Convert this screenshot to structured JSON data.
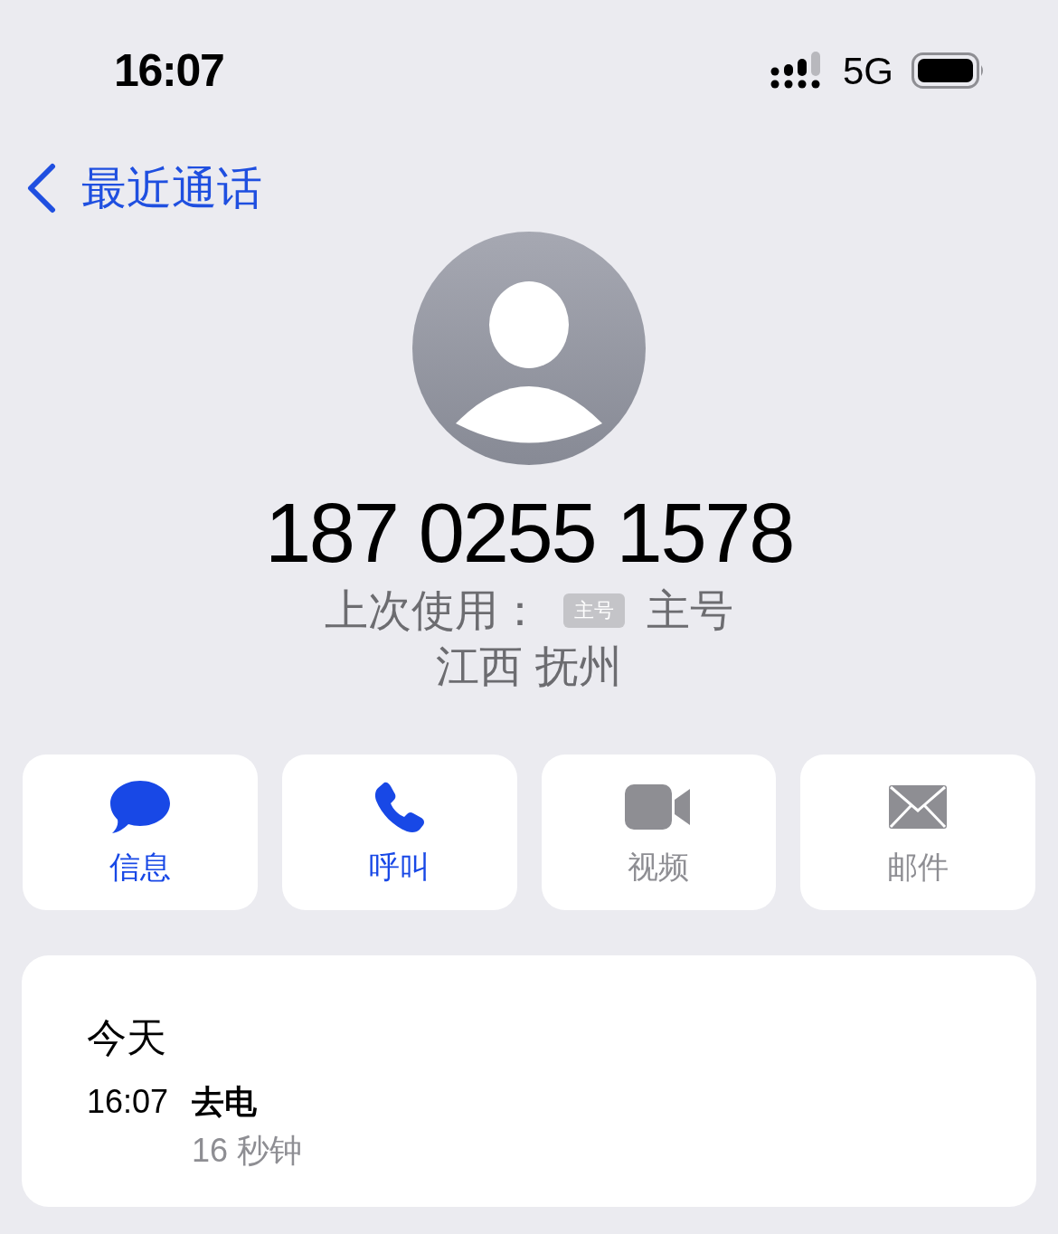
{
  "status_bar": {
    "time": "16:07",
    "network": "5G"
  },
  "nav": {
    "back_label": "最近通话"
  },
  "contact": {
    "number": "187 0255 1578",
    "last_used_label": "上次使用：",
    "line_badge": "主号",
    "line_name": "主号",
    "location": "江西 抚州"
  },
  "actions": [
    {
      "kind": "message",
      "label": "信息",
      "enabled": true
    },
    {
      "kind": "call",
      "label": "呼叫",
      "enabled": true
    },
    {
      "kind": "video",
      "label": "视频",
      "enabled": false
    },
    {
      "kind": "mail",
      "label": "邮件",
      "enabled": false
    }
  ],
  "history": {
    "day": "今天",
    "entries": [
      {
        "time": "16:07",
        "type": "去电",
        "duration": "16 秒钟"
      }
    ]
  }
}
